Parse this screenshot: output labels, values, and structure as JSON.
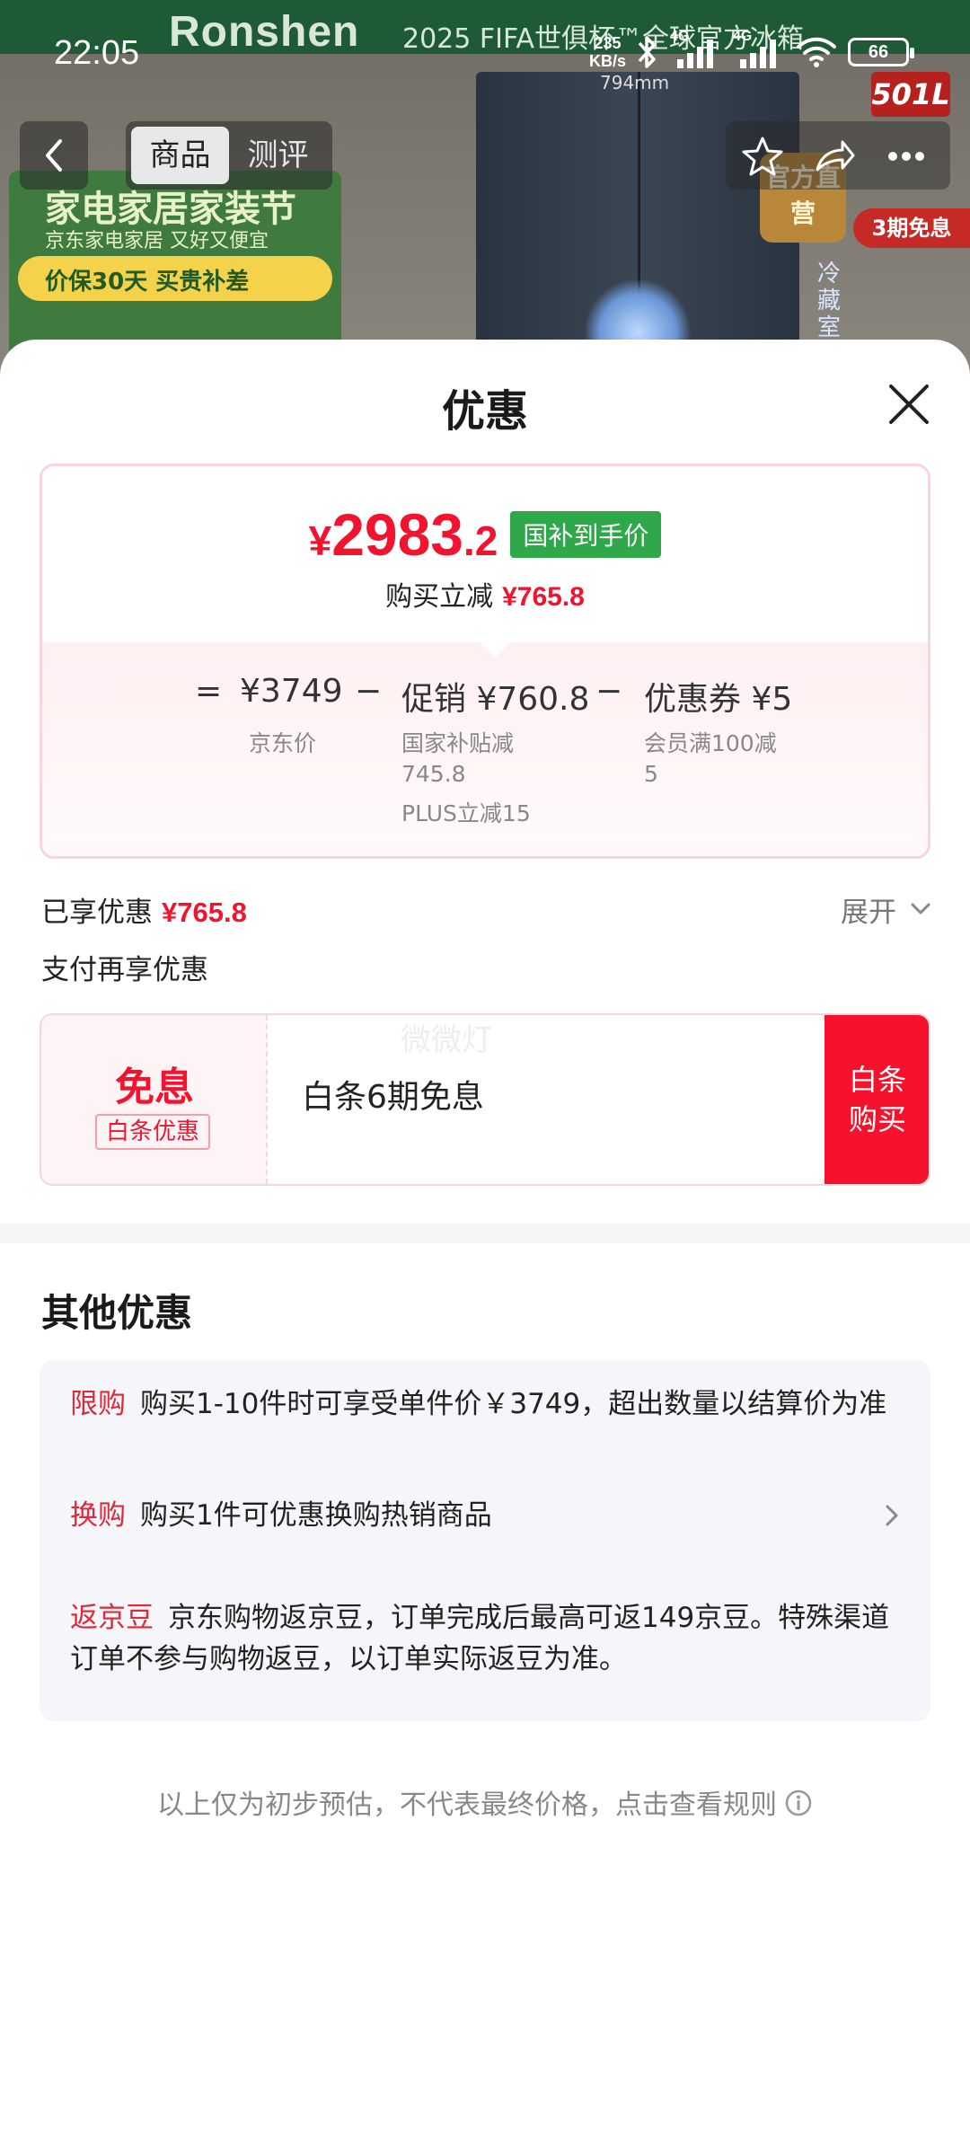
{
  "status_bar": {
    "time": "22:05",
    "net_speed": "235",
    "net_unit": "KB/s",
    "signal_1": "4G",
    "signal_2": "4G",
    "battery": "66"
  },
  "background": {
    "brand": "Ronshen",
    "banner": "2025 FIFA世俱杯™全球官方冰箱",
    "size": "794mm",
    "promo_title": "家电家居家装节",
    "promo_sub": "京东家电家居 又好又便宜",
    "promo_strip": "价保30天 买贵补差",
    "badge_capacity": "501L",
    "badge_official": "官方直营",
    "badge_installment": "3期免息",
    "side_text": "冷藏室",
    "nav_tabs": [
      "商品",
      "测评"
    ]
  },
  "sheet": {
    "title": "优惠"
  },
  "price": {
    "currency": "¥",
    "integer": "2983",
    "decimal": ".2",
    "tag": "国补到手价",
    "sub_label": "购买立减",
    "sub_value": "¥765.8"
  },
  "formula": {
    "equals": "=",
    "base": "¥3749",
    "base_label": "京东价",
    "minus1": "−",
    "promo": "促销 ¥760.8",
    "promo_sub1": "国家补贴减",
    "promo_sub1_value": "745.8",
    "promo_sub2": "PLUS立减15",
    "minus2": "−",
    "coupon": "优惠券 ¥5",
    "coupon_sub1": "会员满100减",
    "coupon_sub1_value": "5"
  },
  "enjoyed": {
    "label": "已享优惠",
    "value": "¥765.8",
    "expand": "展开"
  },
  "pay_more": "支付再享优惠",
  "baitiao": {
    "title": "免息",
    "badge": "白条优惠",
    "desc": "白条6期免息",
    "watermark": "微微灯",
    "buy_line1": "白条",
    "buy_line2": "购买"
  },
  "other": {
    "title": "其他优惠",
    "offers": [
      {
        "tag": "限购",
        "text": "购买1-10件时可享受单件价￥3749，超出数量以结算价为准"
      },
      {
        "tag": "换购",
        "text": "购买1件可优惠换购热销商品"
      },
      {
        "tag": "返京豆",
        "text": "京东购物返京豆，订单完成后最高可返149京豆。特殊渠道订单不参与购物返豆，以订单实际返豆为准。"
      }
    ]
  },
  "footnote": "以上仅为初步预估，不代表最终价格，点击查看规则",
  "colors": {
    "accent_red": "#f2142f",
    "tag_green": "#2fa84a"
  }
}
